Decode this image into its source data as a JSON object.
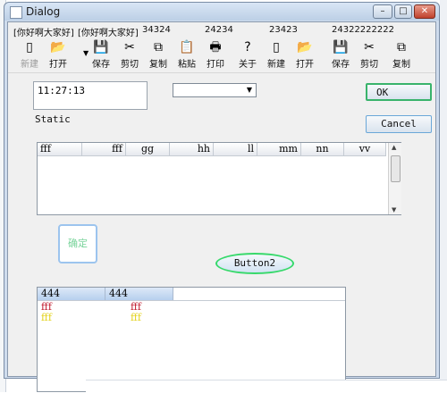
{
  "window": {
    "title": "Dialog",
    "minimize": "–",
    "restore": "□",
    "close": "✕"
  },
  "menu": [
    "[你好啊大家好]",
    "[你好啊大家好]",
    "34324",
    "24234",
    "23423",
    "24322222222"
  ],
  "toolbar": [
    {
      "label": "新建",
      "icon": "new-document-icon",
      "glyph": "▯",
      "enabled": false
    },
    {
      "label": "打开",
      "icon": "open-folder-icon",
      "glyph": "📂",
      "enabled": true
    },
    {
      "label": "保存",
      "icon": "save-disk-icon",
      "glyph": "💾",
      "enabled": true
    },
    {
      "label": "剪切",
      "icon": "scissors-icon",
      "glyph": "✂",
      "enabled": true
    },
    {
      "label": "复制",
      "icon": "copy-icon",
      "glyph": "⧉",
      "enabled": true
    },
    {
      "label": "粘贴",
      "icon": "paste-icon",
      "glyph": "📋",
      "enabled": true
    },
    {
      "label": "打印",
      "icon": "printer-icon",
      "glyph": "🖶",
      "enabled": true
    },
    {
      "label": "关于",
      "icon": "help-icon",
      "glyph": "?",
      "enabled": true
    },
    {
      "label": "新建",
      "icon": "new-document-icon",
      "glyph": "▯",
      "enabled": true
    },
    {
      "label": "打开",
      "icon": "open-folder-icon",
      "glyph": "📂",
      "enabled": true
    },
    {
      "label": "保存",
      "icon": "save-disk-icon",
      "glyph": "💾",
      "enabled": true
    },
    {
      "label": "剪切",
      "icon": "scissors-icon",
      "glyph": "✂",
      "enabled": true
    },
    {
      "label": "复制",
      "icon": "copy-icon",
      "glyph": "⧉",
      "enabled": true
    }
  ],
  "time_value": "11:27:13",
  "static_label": "Static",
  "buttons": {
    "ok": "OK",
    "cancel": "Cancel",
    "confirm": "确定",
    "button2": "Button2"
  },
  "list1": {
    "columns": [
      "fff",
      "fff",
      "gg",
      "hh",
      "ll",
      "mm",
      "nn",
      "vv"
    ]
  },
  "list2": {
    "columns": [
      "444",
      "444"
    ],
    "rows": [
      {
        "cells": [
          "fff",
          "fff"
        ],
        "color": "#c0182a"
      },
      {
        "cells": [
          "fff",
          "fff"
        ],
        "color": "#e3d21a"
      }
    ]
  },
  "colors": {
    "ok_border": "#39b36b",
    "button2_border": "#37d96b",
    "confirm_text": "#78d39a"
  }
}
